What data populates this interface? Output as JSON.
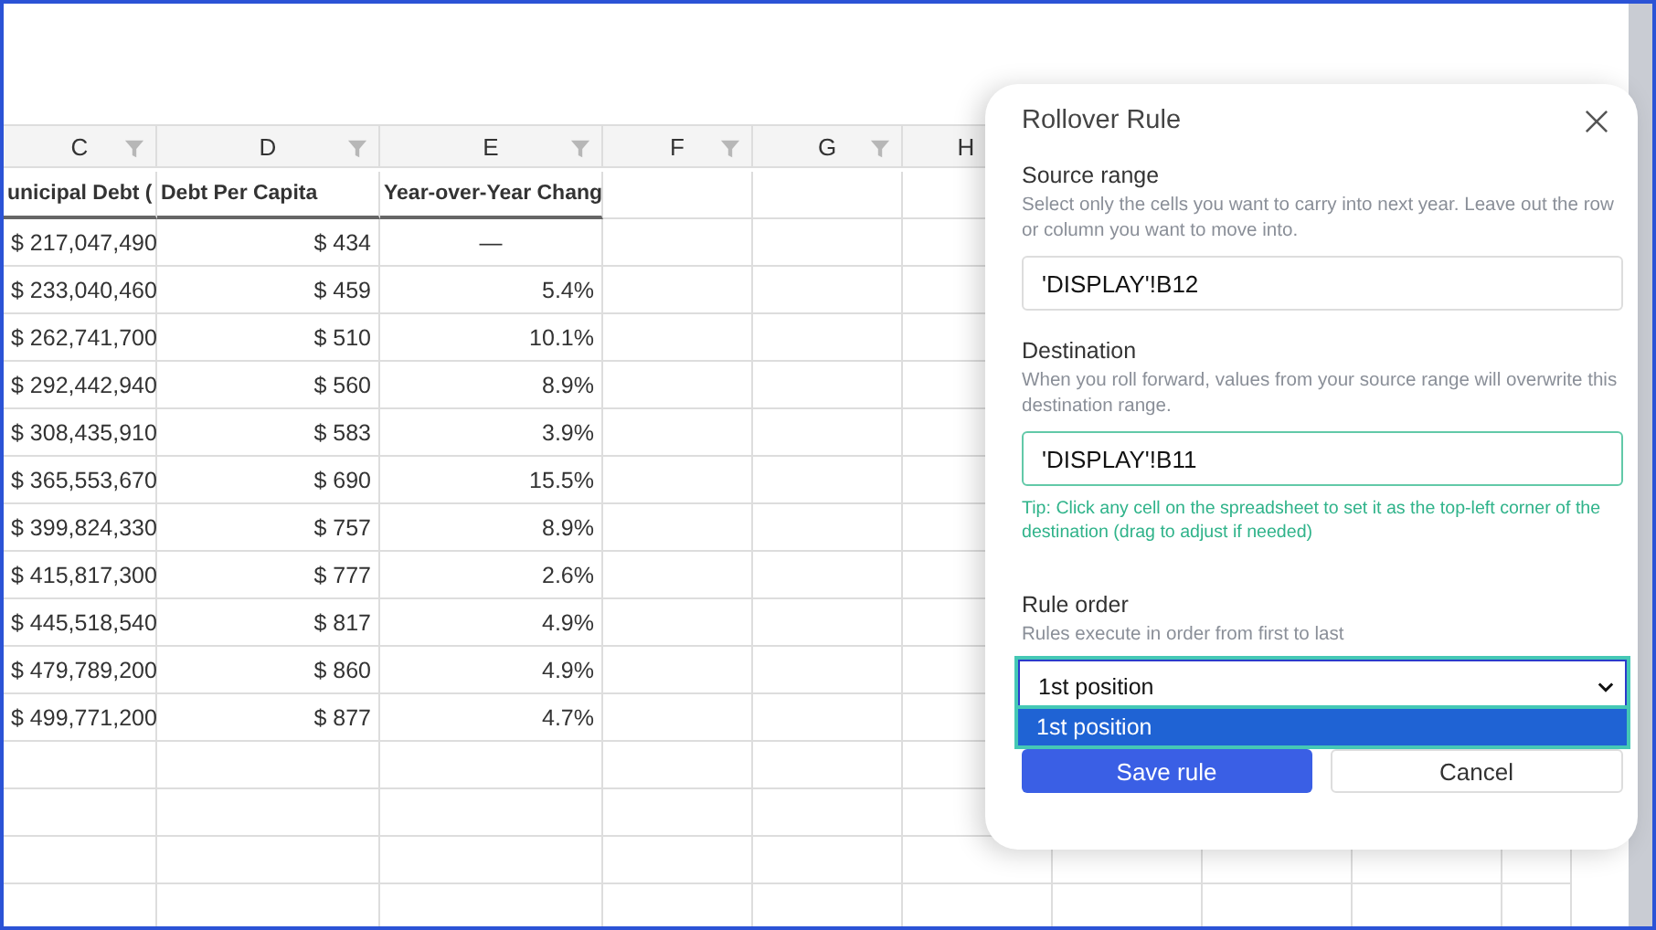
{
  "sheet": {
    "columns": [
      {
        "letter": "C",
        "filter": true
      },
      {
        "letter": "D",
        "filter": true
      },
      {
        "letter": "E",
        "filter": true
      },
      {
        "letter": "F",
        "filter": true
      },
      {
        "letter": "G",
        "filter": true
      },
      {
        "letter": "H",
        "filter": false
      }
    ],
    "headings": [
      "unicipal Debt (",
      "Debt Per Capita",
      "Year-over-Year Chang"
    ],
    "rows": [
      [
        "$ 217,047,490",
        "$ 434",
        "—"
      ],
      [
        "$ 233,040,460",
        "$ 459",
        "5.4%"
      ],
      [
        "$ 262,741,700",
        "$ 510",
        "10.1%"
      ],
      [
        "$ 292,442,940",
        "$ 560",
        "8.9%"
      ],
      [
        "$ 308,435,910",
        "$ 583",
        "3.9%"
      ],
      [
        "$ 365,553,670",
        "$ 690",
        "15.5%"
      ],
      [
        "$ 399,824,330",
        "$ 757",
        "8.9%"
      ],
      [
        "$ 415,817,300",
        "$ 777",
        "2.6%"
      ],
      [
        "$ 445,518,540",
        "$ 817",
        "4.9%"
      ],
      [
        "$ 479,789,200",
        "$ 860",
        "4.9%"
      ],
      [
        "$ 499,771,200",
        "$ 877",
        "4.7%"
      ]
    ]
  },
  "dialog": {
    "title": "Rollover Rule",
    "fields": [
      {
        "label": "Source range",
        "help": "Select only the cells you want to carry into next year. Leave out the row or column you want to move into.",
        "value": "'DISPLAY'!B12",
        "focused": false
      },
      {
        "label": "Destination",
        "help": "When you roll forward, values from your source range will overwrite this destination range.",
        "value": "'DISPLAY'!B11",
        "focused": true,
        "tip": "Tip: Click any cell on the spreadsheet to set it as the top-left corner of the destination (drag to adjust if needed)"
      }
    ],
    "rule_order": {
      "label": "Rule order",
      "help": "Rules execute in order from first to last",
      "value": "1st position",
      "expanded": true,
      "options": [
        {
          "label": "1st position",
          "selected": true
        }
      ]
    },
    "buttons": [
      {
        "label": "Save rule",
        "kind": "primary"
      },
      {
        "label": "Cancel",
        "kind": "secondary"
      }
    ]
  }
}
